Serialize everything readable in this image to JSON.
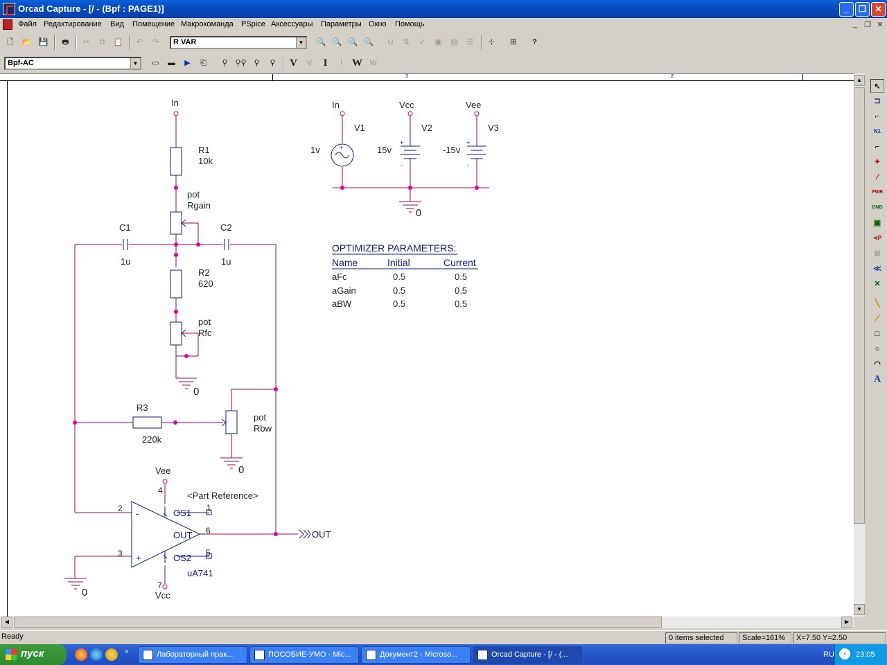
{
  "window": {
    "title": "Orcad Capture - [/ - (Bpf : PAGE1)]",
    "min": "_",
    "max": "❐",
    "close": "✕"
  },
  "menu": [
    "Файл",
    "Редактирование",
    "Вид",
    "Помещение",
    "Макрокоманда",
    "PSpice",
    "Аксессуары",
    "Параметры",
    "Окно",
    "Помощь"
  ],
  "mdi_controls": [
    "_",
    "❐",
    "✕"
  ],
  "toolbar1": {
    "part_combo": "R VAR"
  },
  "toolbar2": {
    "profile_combo": "Bpf-AC",
    "probe_v": "V",
    "probe_i": "I",
    "probe_w": "W"
  },
  "ruler_marks": [
    "3",
    "2"
  ],
  "schematic": {
    "labels": {
      "in_top": "In",
      "r1_ref": "R1",
      "r1_val": "10k",
      "pot_gain_1": "pot",
      "pot_gain_2": "Rgain",
      "c1_ref": "C1",
      "c1_val": "1u",
      "c2_ref": "C2",
      "c2_val": "1u",
      "r2_ref": "R2",
      "r2_val": "620",
      "pot_fc_1": "pot",
      "pot_fc_2": "Rfc",
      "gnd1": "0",
      "r3_ref": "R3",
      "r3_val": "220k",
      "pot_bw_1": "pot",
      "pot_bw_2": "Rbw",
      "gnd2": "0",
      "vee_op": "Vee",
      "part_ref": "<Part Reference>",
      "pin4": "4",
      "pin1": "1",
      "pin2": "2",
      "pin3": "3",
      "pin6": "6",
      "pin5": "5",
      "pin7": "7",
      "minus": "-",
      "plus": "+",
      "os1": "OS1",
      "out_pin": "OUT",
      "os2": "OS2",
      "opamp_val": "uA741",
      "vcc_op": "Vcc",
      "gnd3": "0",
      "out_port": "OUT",
      "src_in": "In",
      "v1": "V1",
      "v1_val": "1v",
      "src_vcc": "Vcc",
      "v2": "V2",
      "v2_val": "15v",
      "src_vee": "Vee",
      "v3": "V3",
      "v3_val": "-15v",
      "gnd4": "0"
    },
    "optimizer": {
      "title": "OPTIMIZER PARAMETERS:",
      "headers": [
        "Name",
        "Initial",
        "Current"
      ],
      "rows": [
        [
          "aFc",
          "0.5",
          "0.5"
        ],
        [
          "aGain",
          "0.5",
          "0.5"
        ],
        [
          "aBW",
          "0.5",
          "0.5"
        ]
      ]
    }
  },
  "status": {
    "ready": "Ready",
    "selected": "0 items selected",
    "scale": "Scale=161%",
    "coords": "X=7.50  Y=2.50"
  },
  "taskbar": {
    "start": "пуск",
    "tasks": [
      "Лабораторный прак...",
      "ПОСОБИЕ-УМО - Mic...",
      "Документ2 - Microso...",
      "Orcad Capture - [/ - (..."
    ],
    "lang": "RU",
    "clock": "23:05"
  }
}
